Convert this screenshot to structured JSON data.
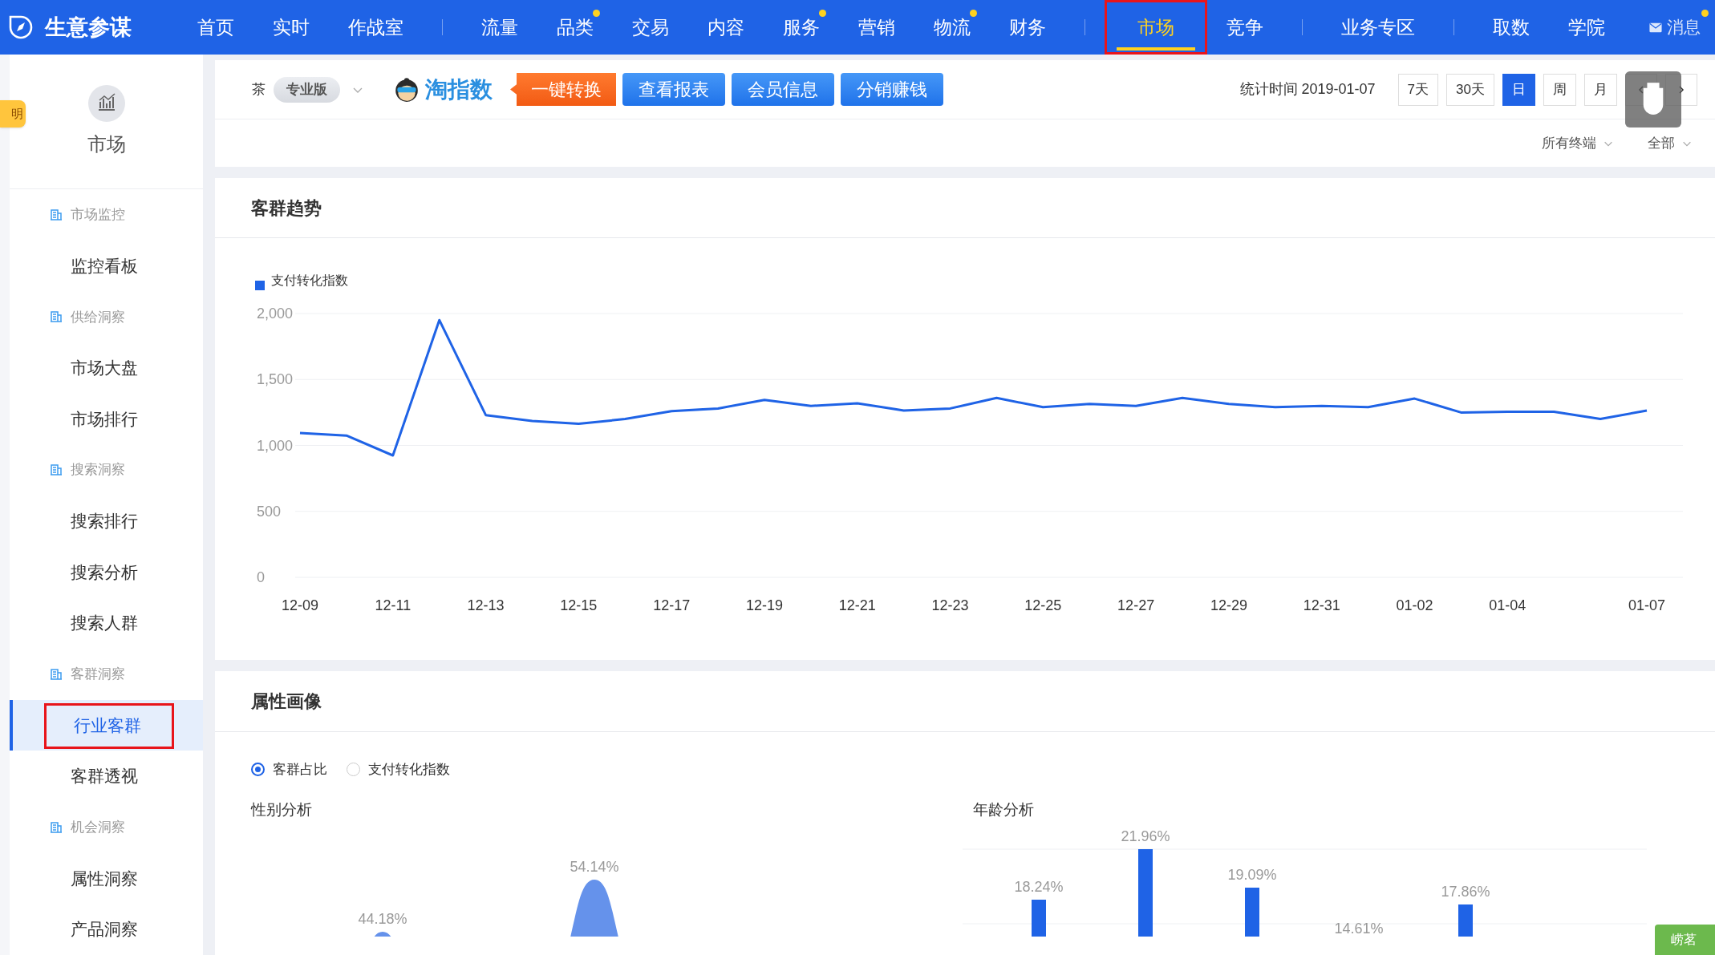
{
  "header": {
    "logo": "生意参谋",
    "nav_groups": [
      [
        {
          "label": "首页",
          "selected": false,
          "dot": false,
          "marked": false
        },
        {
          "label": "实时",
          "selected": false,
          "dot": false,
          "marked": false
        },
        {
          "label": "作战室",
          "selected": false,
          "dot": false,
          "marked": false
        }
      ],
      [
        {
          "label": "流量",
          "selected": false,
          "dot": false,
          "marked": false
        },
        {
          "label": "品类",
          "selected": false,
          "dot": true,
          "marked": false
        },
        {
          "label": "交易",
          "selected": false,
          "dot": false,
          "marked": false
        },
        {
          "label": "内容",
          "selected": false,
          "dot": false,
          "marked": false
        },
        {
          "label": "服务",
          "selected": false,
          "dot": true,
          "marked": false
        },
        {
          "label": "营销",
          "selected": false,
          "dot": false,
          "marked": false
        },
        {
          "label": "物流",
          "selected": false,
          "dot": true,
          "marked": false
        },
        {
          "label": "财务",
          "selected": false,
          "dot": false,
          "marked": false
        }
      ],
      [
        {
          "label": "市场",
          "selected": true,
          "dot": false,
          "marked": true
        },
        {
          "label": "竞争",
          "selected": false,
          "dot": false,
          "marked": false
        }
      ],
      [
        {
          "label": "业务专区",
          "selected": false,
          "dot": false,
          "marked": false
        }
      ],
      [
        {
          "label": "取数",
          "selected": false,
          "dot": false,
          "marked": false
        },
        {
          "label": "学院",
          "selected": false,
          "dot": false,
          "marked": false
        }
      ]
    ],
    "messages": {
      "label": "消息",
      "dot": true
    }
  },
  "side_badge": "明",
  "sidebar": {
    "title": "市场",
    "groups": [
      {
        "label": "市场监控",
        "children": [
          {
            "label": "监控看板",
            "selected": false,
            "marked": false
          }
        ]
      },
      {
        "label": "供给洞察",
        "children": [
          {
            "label": "市场大盘",
            "selected": false,
            "marked": false
          },
          {
            "label": "市场排行",
            "selected": false,
            "marked": false
          }
        ]
      },
      {
        "label": "搜索洞察",
        "children": [
          {
            "label": "搜索排行",
            "selected": false,
            "marked": false
          },
          {
            "label": "搜索分析",
            "selected": false,
            "marked": false
          },
          {
            "label": "搜索人群",
            "selected": false,
            "marked": false
          }
        ]
      },
      {
        "label": "客群洞察",
        "children": [
          {
            "label": "行业客群",
            "selected": true,
            "marked": true
          },
          {
            "label": "客群透视",
            "selected": false,
            "marked": false
          }
        ]
      },
      {
        "label": "机会洞察",
        "children": [
          {
            "label": "属性洞察",
            "selected": false,
            "marked": false
          },
          {
            "label": "产品洞察",
            "selected": false,
            "marked": false
          }
        ]
      }
    ]
  },
  "toolbar": {
    "category": "茶",
    "edition": "专业版",
    "brand": "淘指数",
    "buttons": [
      {
        "label": "一键转换",
        "kind": "orange"
      },
      {
        "label": "查看报表",
        "kind": "blue"
      },
      {
        "label": "会员信息",
        "kind": "blue"
      },
      {
        "label": "分销赚钱",
        "kind": "blue"
      }
    ],
    "stat_time": "统计时间 2019-01-07",
    "periods": [
      {
        "label": "7天",
        "selected": false
      },
      {
        "label": "30天",
        "selected": false
      },
      {
        "label": "日",
        "selected": true
      },
      {
        "label": "周",
        "selected": false
      },
      {
        "label": "月",
        "selected": false
      }
    ],
    "filters": [
      {
        "label": "所有终端"
      },
      {
        "label": "全部"
      }
    ]
  },
  "trend": {
    "title": "客群趋势",
    "chart_data": {
      "type": "line",
      "grid": true,
      "categories": [
        "12-09",
        null,
        "12-11",
        null,
        "12-13",
        null,
        "12-15",
        null,
        "12-17",
        null,
        "12-19",
        null,
        "12-21",
        null,
        "12-23",
        null,
        "12-25",
        null,
        "12-27",
        null,
        "12-29",
        null,
        "12-31",
        null,
        "01-02",
        null,
        "01-04",
        null,
        null,
        "01-07"
      ],
      "series": [
        {
          "name": "支付转化指数",
          "color": "#1f63e6",
          "values": [
            1095,
            1075,
            924,
            1950,
            1230,
            1185,
            1165,
            1200,
            1260,
            1280,
            1345,
            1300,
            1320,
            1265,
            1280,
            1360,
            1290,
            1315,
            1300,
            1360,
            1315,
            1290,
            1300,
            1290,
            1355,
            1250,
            1255,
            1255,
            1200,
            1265
          ]
        }
      ],
      "ylim": [
        0,
        2000
      ],
      "yticks": [
        {
          "value": 0,
          "label": "0"
        },
        {
          "value": 500,
          "label": "500"
        },
        {
          "value": 1000,
          "label": "1,000"
        },
        {
          "value": 1500,
          "label": "1,500"
        },
        {
          "value": 2000,
          "label": "2,000"
        }
      ]
    }
  },
  "portrait": {
    "title": "属性画像",
    "options": [
      {
        "label": "客群占比",
        "selected": true
      },
      {
        "label": "支付转化指数",
        "selected": false
      }
    ],
    "gender": {
      "title": "性别分析",
      "bar_labels": [
        "44.18%",
        "54.14%"
      ]
    },
    "age": {
      "title": "年龄分析",
      "bar_labels": [
        "18.24%",
        "21.96%",
        "19.09%",
        "14.61%",
        "17.86%"
      ]
    }
  },
  "corner_tag": "崂茗"
}
